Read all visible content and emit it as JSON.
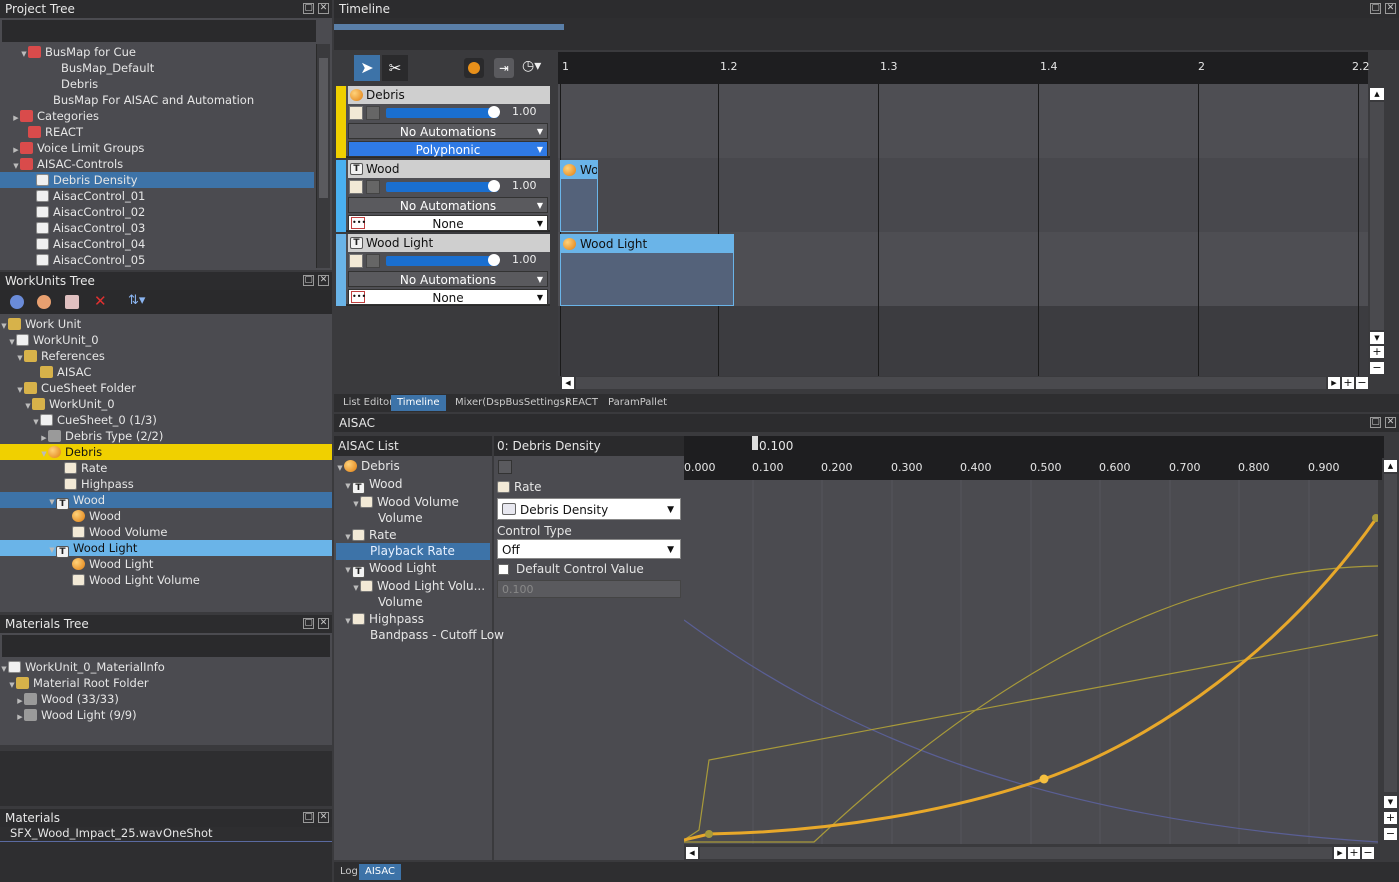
{
  "project_tree": {
    "title": "Project Tree",
    "items": [
      {
        "label": "BusMap for Cue",
        "icon": "bus-map-folder-icon"
      },
      {
        "label": "BusMap_Default",
        "icon": "bus-map-icon"
      },
      {
        "label": "Debris",
        "icon": "bus-map-icon"
      },
      {
        "label": "BusMap For AISAC and Automation",
        "icon": "bus-map-icon"
      },
      {
        "label": "Categories",
        "icon": "folder-icon"
      },
      {
        "label": "REACT",
        "icon": "folder-icon"
      },
      {
        "label": "Voice Limit Groups",
        "icon": "folder-icon"
      },
      {
        "label": "AISAC-Controls",
        "icon": "folder-icon"
      },
      {
        "label": "Debris Density",
        "icon": "aisac-control-icon"
      },
      {
        "label": "AisacControl_01",
        "icon": "aisac-control-icon"
      },
      {
        "label": "AisacControl_02",
        "icon": "aisac-control-icon"
      },
      {
        "label": "AisacControl_03",
        "icon": "aisac-control-icon"
      },
      {
        "label": "AisacControl_04",
        "icon": "aisac-control-icon"
      },
      {
        "label": "AisacControl_05",
        "icon": "aisac-control-icon"
      }
    ]
  },
  "workunits_tree": {
    "title": "WorkUnits Tree",
    "items": [
      {
        "label": "Work Unit"
      },
      {
        "label": "WorkUnit_0"
      },
      {
        "label": "References"
      },
      {
        "label": "AISAC"
      },
      {
        "label": "CueSheet Folder"
      },
      {
        "label": "WorkUnit_0"
      },
      {
        "label": "CueSheet_0 (1/3)"
      },
      {
        "label": "Debris Type (2/2)"
      },
      {
        "label": "Debris"
      },
      {
        "label": "Rate"
      },
      {
        "label": "Highpass"
      },
      {
        "label": "Wood"
      },
      {
        "label": "Wood"
      },
      {
        "label": "Wood Volume"
      },
      {
        "label": "Wood Light"
      },
      {
        "label": "Wood Light"
      },
      {
        "label": "Wood Light Volume"
      }
    ]
  },
  "materials_tree": {
    "title": "Materials Tree",
    "items": [
      {
        "label": "WorkUnit_0_MaterialInfo"
      },
      {
        "label": "Material Root Folder"
      },
      {
        "label": "Wood (33/33)"
      },
      {
        "label": "Wood Light (9/9)"
      }
    ]
  },
  "materials": {
    "title": "Materials",
    "file": "SFX_Wood_Impact_25.wav",
    "mode": "OneShot"
  },
  "timeline": {
    "title": "Timeline",
    "ruler": [
      "1",
      "1.2",
      "1.3",
      "1.4",
      "2",
      "2.2"
    ],
    "tracks": [
      {
        "name": "Debris",
        "value": "1.00",
        "automation": "No Automations",
        "mode": "Polyphonic",
        "color": "#f0d000"
      },
      {
        "name": "Wood",
        "value": "1.00",
        "automation": "No Automations",
        "mode": "None",
        "color": "#4ab0f0",
        "clip": "Wo"
      },
      {
        "name": "Wood Light",
        "value": "1.00",
        "automation": "No Automations",
        "mode": "None",
        "color": "#6ab4e8",
        "clip": "Wood Light"
      }
    ],
    "tabs": [
      "List Editor",
      "Timeline",
      "Mixer(DspBusSettings)",
      "REACT",
      "ParamPallet"
    ]
  },
  "aisac": {
    "title": "AISAC",
    "list_title": "AISAC List",
    "list": [
      {
        "label": "Debris"
      },
      {
        "label": "Wood"
      },
      {
        "label": "Wood Volume"
      },
      {
        "label": "Volume"
      },
      {
        "label": "Rate"
      },
      {
        "label": "Playback Rate"
      },
      {
        "label": "Wood Light"
      },
      {
        "label": "Wood Light Volu..."
      },
      {
        "label": "Volume"
      },
      {
        "label": "Highpass"
      },
      {
        "label": "Bandpass - Cutoff Low"
      }
    ],
    "header": "0: Debris Density",
    "cursor_value": "0.100",
    "props": {
      "rate_label": "Rate",
      "control": "Debris Density",
      "control_type_label": "Control Type",
      "control_type": "Off",
      "default_label": "Default Control Value",
      "default_value": "0.100"
    },
    "axis": [
      "0.000",
      "0.100",
      "0.200",
      "0.300",
      "0.400",
      "0.500",
      "0.600",
      "0.700",
      "0.800",
      "0.900"
    ],
    "bottom_tabs": [
      "Log",
      "AISAC"
    ]
  },
  "colors": {
    "accent": "#3d73a8",
    "curve_main": "#e8a82a",
    "curve_thin": "#a89a3a",
    "curve_blue": "#5a5f95",
    "highlight_yellow": "#f0d000"
  }
}
